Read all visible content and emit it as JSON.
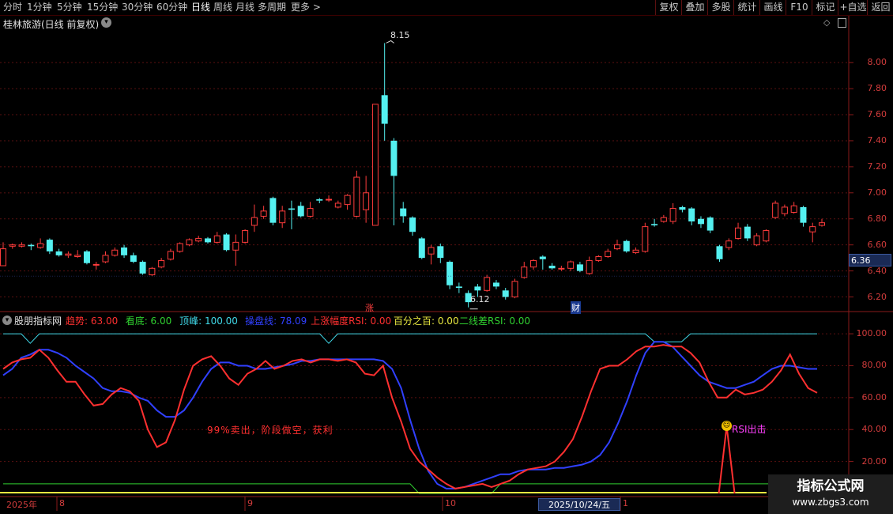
{
  "toolbar": {
    "periods": [
      "分时",
      "1分钟",
      "5分钟",
      "15分钟",
      "30分钟",
      "60分钟",
      "日线",
      "周线",
      "月线",
      "多周期",
      "更多"
    ],
    "active_period": "日线",
    "more_arrow": ">",
    "right_buttons": [
      "复权",
      "叠加",
      "多股",
      "统计",
      "画线",
      "F10",
      "标记",
      "+自选",
      "返回"
    ]
  },
  "main_chart": {
    "title": "桂林旅游(日线 前复权)",
    "high_label": "8.15",
    "low_label": "6.12",
    "current_price": "6.36",
    "y_ticks": [
      "8.00",
      "7.80",
      "7.60",
      "7.40",
      "7.20",
      "7.00",
      "6.80",
      "6.60",
      "6.40",
      "6.20"
    ],
    "markers": [
      "涨",
      "财"
    ]
  },
  "indicator": {
    "name": "股朋指标网",
    "fields": [
      {
        "label": "趋势: 63.00",
        "color": "#ff3030"
      },
      {
        "label": "看底: 6.00",
        "color": "#30d030"
      },
      {
        "label": "顶峰: 100.00",
        "color": "#40d8e8"
      },
      {
        "label": "操盘线: 78.09",
        "color": "#3040ff"
      },
      {
        "label": "上涨幅度RSI: 0.00",
        "color": "#ff3030"
      },
      {
        "label": "百分之百: 0.00",
        "color": "#e8e840"
      },
      {
        "label": "二线差RSI: 0.00",
        "color": "#30d030"
      }
    ],
    "y_ticks": [
      "100.00",
      "80.00",
      "60.00",
      "40.00",
      "20.00"
    ],
    "annotation_left": "99%卖出，阶段做空，获利",
    "annotation_right": "RSI出击"
  },
  "x_axis": {
    "labels": [
      "2025年",
      "8",
      "9",
      "10",
      "1"
    ],
    "cursor_date": "2025/10/24/五"
  },
  "watermark": {
    "line1": "指标公式网",
    "line2": "www.zbgs3.com"
  },
  "chart_data": {
    "type": "candlestick",
    "title": "桂林旅游(日线 前复权)",
    "ylim": [
      6.1,
      8.25
    ],
    "candles": [
      [
        6.44,
        6.57,
        6.62,
        6.44
      ],
      [
        6.59,
        6.6,
        6.61,
        6.57
      ],
      [
        6.59,
        6.6,
        6.62,
        6.58
      ],
      [
        6.6,
        6.59,
        6.61,
        6.56
      ],
      [
        6.58,
        6.61,
        6.65,
        6.57
      ],
      [
        6.64,
        6.55,
        6.65,
        6.53
      ],
      [
        6.55,
        6.52,
        6.57,
        6.51
      ],
      [
        6.52,
        6.53,
        6.55,
        6.5
      ],
      [
        6.51,
        6.52,
        6.56,
        6.5
      ],
      [
        6.55,
        6.46,
        6.56,
        6.45
      ],
      [
        6.45,
        6.45,
        6.47,
        6.41
      ],
      [
        6.47,
        6.52,
        6.55,
        6.46
      ],
      [
        6.52,
        6.56,
        6.58,
        6.51
      ],
      [
        6.58,
        6.52,
        6.6,
        6.5
      ],
      [
        6.52,
        6.47,
        6.54,
        6.46
      ],
      [
        6.47,
        6.38,
        6.48,
        6.37
      ],
      [
        6.37,
        6.42,
        6.43,
        6.36
      ],
      [
        6.43,
        6.48,
        6.5,
        6.42
      ],
      [
        6.49,
        6.55,
        6.57,
        6.48
      ],
      [
        6.55,
        6.61,
        6.62,
        6.54
      ],
      [
        6.6,
        6.64,
        6.65,
        6.59
      ],
      [
        6.63,
        6.65,
        6.67,
        6.62
      ],
      [
        6.65,
        6.62,
        6.66,
        6.61
      ],
      [
        6.62,
        6.67,
        6.7,
        6.61
      ],
      [
        6.68,
        6.56,
        6.69,
        6.55
      ],
      [
        6.56,
        6.62,
        6.68,
        6.44
      ],
      [
        6.62,
        6.71,
        6.72,
        6.61
      ],
      [
        6.75,
        6.81,
        6.91,
        6.7
      ],
      [
        6.82,
        6.86,
        6.9,
        6.8
      ],
      [
        6.96,
        6.77,
        6.97,
        6.75
      ],
      [
        6.77,
        6.86,
        6.9,
        6.73
      ],
      [
        6.88,
        6.87,
        6.94,
        6.72
      ],
      [
        6.9,
        6.82,
        6.93,
        6.81
      ],
      [
        6.82,
        6.88,
        6.93,
        6.81
      ],
      [
        6.95,
        6.94,
        6.96,
        6.92
      ],
      [
        6.95,
        6.95,
        6.98,
        6.93
      ],
      [
        6.89,
        6.92,
        6.94,
        6.88
      ],
      [
        6.91,
        6.98,
        6.99,
        6.87
      ],
      [
        6.82,
        7.12,
        7.17,
        6.81
      ],
      [
        6.87,
        7.0,
        7.13,
        6.77
      ],
      [
        6.75,
        7.68,
        7.68,
        6.75
      ],
      [
        7.75,
        7.53,
        8.15,
        7.4
      ],
      [
        7.4,
        7.13,
        7.42,
        6.75
      ],
      [
        6.88,
        6.82,
        6.93,
        6.77
      ],
      [
        6.81,
        6.7,
        6.82,
        6.67
      ],
      [
        6.65,
        6.5,
        6.66,
        6.49
      ],
      [
        6.53,
        6.58,
        6.6,
        6.45
      ],
      [
        6.59,
        6.5,
        6.61,
        6.46
      ],
      [
        6.47,
        6.29,
        6.48,
        6.26
      ],
      [
        6.28,
        6.27,
        6.31,
        6.23
      ],
      [
        6.23,
        6.16,
        6.25,
        6.12
      ],
      [
        6.28,
        6.25,
        6.3,
        6.2
      ],
      [
        6.25,
        6.35,
        6.37,
        6.24
      ],
      [
        6.31,
        6.28,
        6.33,
        6.26
      ],
      [
        6.25,
        6.2,
        6.27,
        6.18
      ],
      [
        6.2,
        6.32,
        6.34,
        6.19
      ],
      [
        6.35,
        6.43,
        6.47,
        6.34
      ],
      [
        6.43,
        6.48,
        6.49,
        6.41
      ],
      [
        6.51,
        6.49,
        6.52,
        6.41
      ],
      [
        6.44,
        6.42,
        6.46,
        6.41
      ],
      [
        6.42,
        6.42,
        6.44,
        6.4
      ],
      [
        6.42,
        6.47,
        6.48,
        6.4
      ],
      [
        6.45,
        6.4,
        6.47,
        6.39
      ],
      [
        6.38,
        6.48,
        6.51,
        6.37
      ],
      [
        6.48,
        6.51,
        6.52,
        6.47
      ],
      [
        6.51,
        6.55,
        6.57,
        6.5
      ],
      [
        6.57,
        6.6,
        6.64,
        6.56
      ],
      [
        6.63,
        6.55,
        6.64,
        6.54
      ],
      [
        6.54,
        6.56,
        6.58,
        6.53
      ],
      [
        6.55,
        6.74,
        6.77,
        6.54
      ],
      [
        6.76,
        6.75,
        6.8,
        6.74
      ],
      [
        6.78,
        6.81,
        6.83,
        6.77
      ],
      [
        6.78,
        6.88,
        6.92,
        6.76
      ],
      [
        6.89,
        6.87,
        6.9,
        6.85
      ],
      [
        6.88,
        6.78,
        6.89,
        6.75
      ],
      [
        6.8,
        6.76,
        6.82,
        6.73
      ],
      [
        6.81,
        6.71,
        6.82,
        6.69
      ],
      [
        6.59,
        6.49,
        6.6,
        6.47
      ],
      [
        6.58,
        6.63,
        6.65,
        6.56
      ],
      [
        6.65,
        6.73,
        6.77,
        6.64
      ],
      [
        6.74,
        6.65,
        6.76,
        6.63
      ],
      [
        6.6,
        6.67,
        6.69,
        6.59
      ],
      [
        6.63,
        6.71,
        6.72,
        6.62
      ],
      [
        6.81,
        6.92,
        6.94,
        6.8
      ],
      [
        6.84,
        6.89,
        6.91,
        6.82
      ],
      [
        6.85,
        6.9,
        6.93,
        6.84
      ],
      [
        6.89,
        6.77,
        6.9,
        6.74
      ],
      [
        6.7,
        6.74,
        6.77,
        6.62
      ],
      [
        6.75,
        6.77,
        6.8,
        6.74
      ]
    ],
    "indicator_series": [
      {
        "name": "趋势",
        "color": "#ff3030",
        "values": [
          78,
          82,
          84,
          85,
          90,
          85,
          77,
          70,
          70,
          62,
          55,
          56,
          62,
          66,
          64,
          58,
          40,
          29,
          32,
          46,
          65,
          80,
          84,
          86,
          80,
          72,
          68,
          75,
          78,
          83,
          78,
          80,
          83,
          84,
          82,
          84,
          84,
          83,
          84,
          82,
          75,
          74,
          80,
          60,
          45,
          28,
          20,
          15,
          10,
          6,
          3,
          4,
          5,
          6,
          4,
          6,
          8,
          12,
          15,
          16,
          17,
          20,
          26,
          34,
          48,
          64,
          78,
          80,
          80,
          84,
          89,
          92,
          92,
          93,
          92,
          92,
          88,
          82,
          70,
          60,
          60,
          65,
          62,
          63,
          65,
          70,
          77,
          87,
          75,
          66,
          63
        ]
      },
      {
        "name": "操盘线",
        "color": "#3040ff",
        "values": [
          74,
          78,
          85,
          87,
          90,
          90,
          88,
          85,
          80,
          76,
          72,
          66,
          64,
          64,
          63,
          60,
          58,
          52,
          48,
          48,
          52,
          60,
          70,
          78,
          82,
          82,
          80,
          80,
          78,
          78,
          79,
          80,
          81,
          83,
          83,
          84,
          84,
          84,
          84,
          84,
          84,
          84,
          83,
          78,
          66,
          46,
          28,
          14,
          6,
          3,
          3,
          4,
          6,
          8,
          10,
          12,
          12,
          14,
          15,
          15,
          15,
          16,
          16,
          17,
          18,
          20,
          24,
          32,
          44,
          58,
          74,
          88,
          95,
          95,
          92,
          86,
          80,
          74,
          70,
          68,
          66,
          66,
          68,
          70,
          74,
          78,
          80,
          80,
          79,
          78,
          78
        ]
      },
      {
        "name": "顶峰",
        "color": "#40d8e8",
        "values": [
          100,
          100,
          100,
          94,
          100,
          100,
          100,
          100,
          100,
          100,
          100,
          100,
          100,
          100,
          100,
          100,
          100,
          100,
          100,
          100,
          100,
          100,
          100,
          100,
          100,
          100,
          100,
          100,
          100,
          100,
          100,
          100,
          100,
          100,
          100,
          100,
          94,
          100,
          100,
          100,
          100,
          100,
          100,
          100,
          100,
          100,
          100,
          100,
          100,
          100,
          100,
          100,
          100,
          100,
          100,
          100,
          100,
          100,
          100,
          100,
          100,
          100,
          100,
          100,
          100,
          100,
          100,
          100,
          100,
          100,
          100,
          100,
          95,
          95,
          95,
          95,
          100,
          100,
          100,
          100,
          100,
          100,
          100,
          100,
          100,
          100,
          100,
          100,
          100,
          100,
          100
        ]
      },
      {
        "name": "看底",
        "color": "#30d030",
        "values": [
          6,
          6,
          6,
          6,
          6,
          6,
          6,
          6,
          6,
          6,
          6,
          6,
          6,
          6,
          6,
          6,
          6,
          6,
          6,
          6,
          6,
          6,
          6,
          6,
          6,
          6,
          6,
          6,
          6,
          6,
          6,
          6,
          6,
          6,
          6,
          6,
          6,
          6,
          6,
          6,
          6,
          6,
          6,
          6,
          6,
          6,
          0,
          0,
          0,
          0,
          0,
          0,
          0,
          0,
          0,
          6,
          6,
          6,
          6,
          6,
          6,
          6,
          6,
          6,
          6,
          6,
          6,
          6,
          6,
          6,
          6,
          6,
          6,
          6,
          6,
          6,
          6,
          6,
          6,
          6,
          6,
          6,
          6,
          6,
          6,
          6,
          6,
          6,
          6,
          6,
          6
        ]
      }
    ],
    "rsi_spike": {
      "index": 80,
      "value": 42
    },
    "indicator_ylim": [
      -2,
      105
    ]
  }
}
